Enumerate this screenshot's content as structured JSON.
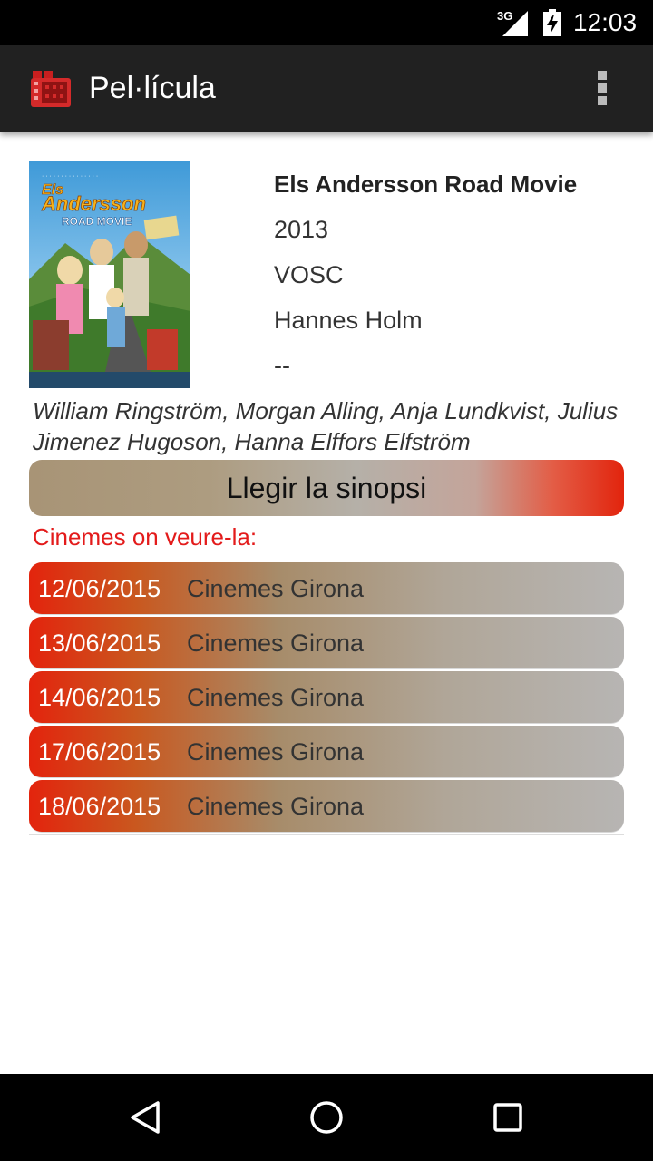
{
  "status_bar": {
    "network": "3G",
    "time": "12:03",
    "icons": [
      "signal-icon",
      "battery-charging-icon"
    ]
  },
  "app_bar": {
    "title": "Pel·lícula",
    "icons": [
      "film-reel-icon",
      "overflow-menu-icon"
    ]
  },
  "movie": {
    "title": "Els Andersson Road Movie",
    "year": "2013",
    "version": "VOSC",
    "director": "Hannes Holm",
    "extra": "--",
    "cast": "William Ringström, Morgan Alling, Anja Lundkvist, Julius Jimenez Hugoson, Hanna Elffors Elfström",
    "poster": {
      "title_line1": "Els",
      "title_line2": "Andersson",
      "title_line3": "ROAD MOVIE"
    }
  },
  "synopsis_button": "Llegir la sinopsi",
  "where_label": "Cinemes on veure-la:",
  "screenings": [
    {
      "date": "12/06/2015",
      "cinema": "Cinemes Girona"
    },
    {
      "date": "13/06/2015",
      "cinema": "Cinemes Girona"
    },
    {
      "date": "14/06/2015",
      "cinema": "Cinemes Girona"
    },
    {
      "date": "17/06/2015",
      "cinema": "Cinemes Girona"
    },
    {
      "date": "18/06/2015",
      "cinema": "Cinemes Girona"
    }
  ],
  "nav_bar": {
    "icons": [
      "back-icon",
      "home-icon",
      "recents-icon"
    ]
  },
  "colors": {
    "accent": "#e31b1b",
    "app_bar": "#212121"
  }
}
